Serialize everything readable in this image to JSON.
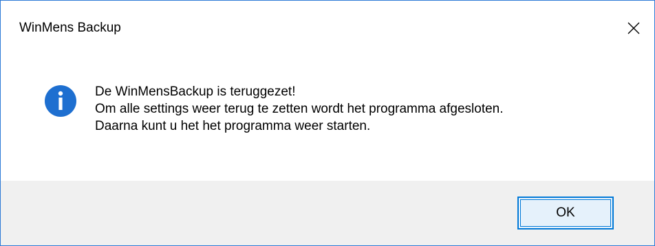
{
  "window": {
    "title": "WinMens Backup",
    "close_icon": "close-icon"
  },
  "message": {
    "icon": "info-icon",
    "lines": [
      "De WinMensBackup is teruggezet!",
      "Om alle settings weer terug te zetten wordt het programma afgesloten.",
      "Daarna kunt u het het programma weer starten."
    ]
  },
  "buttons": {
    "ok_label": "OK"
  },
  "colors": {
    "accent": "#0078d7",
    "info_icon": "#1e6fd0",
    "footer_bg": "#f0f0f0"
  }
}
